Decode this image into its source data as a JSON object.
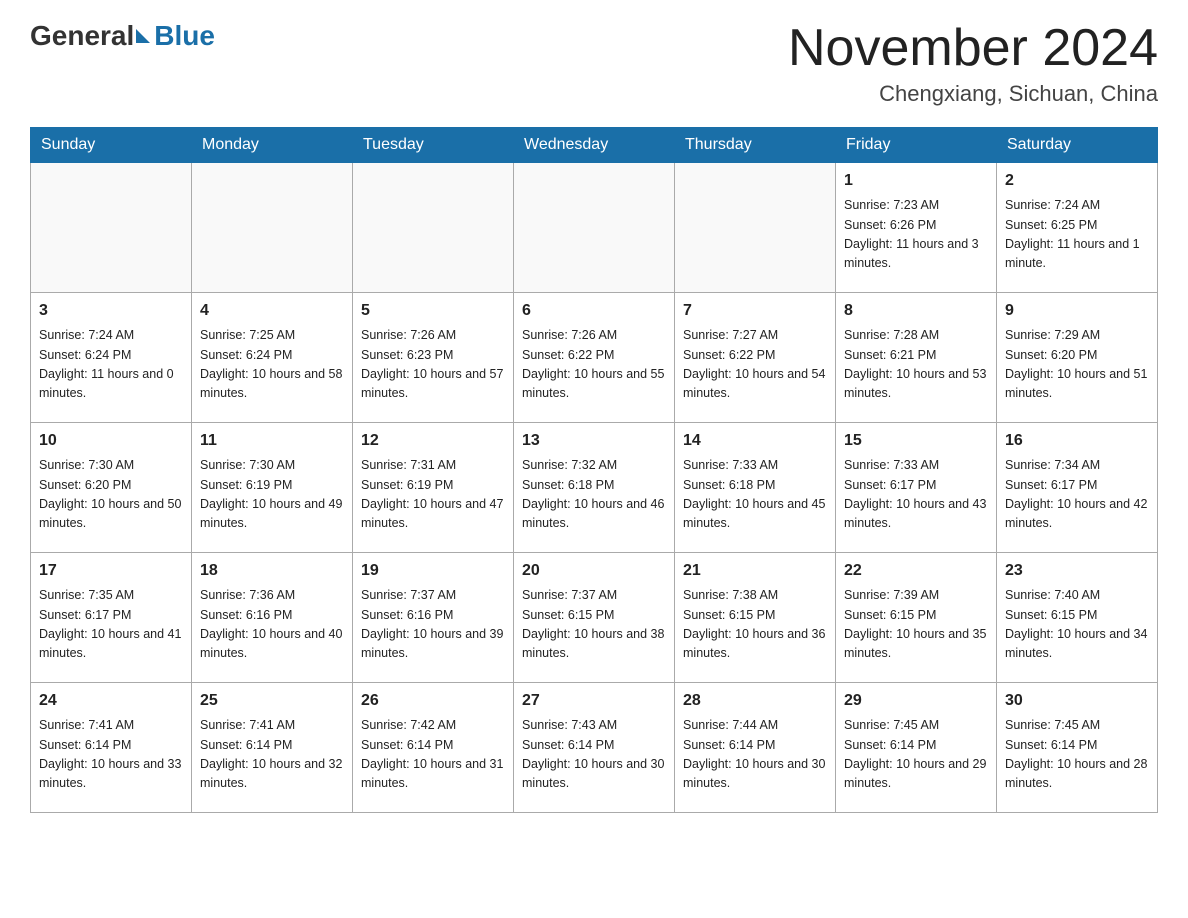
{
  "header": {
    "logo_general": "General",
    "logo_blue": "Blue",
    "month_title": "November 2024",
    "location": "Chengxiang, Sichuan, China"
  },
  "weekdays": [
    "Sunday",
    "Monday",
    "Tuesday",
    "Wednesday",
    "Thursday",
    "Friday",
    "Saturday"
  ],
  "weeks": [
    [
      {
        "day": "",
        "info": ""
      },
      {
        "day": "",
        "info": ""
      },
      {
        "day": "",
        "info": ""
      },
      {
        "day": "",
        "info": ""
      },
      {
        "day": "",
        "info": ""
      },
      {
        "day": "1",
        "info": "Sunrise: 7:23 AM\nSunset: 6:26 PM\nDaylight: 11 hours and 3 minutes."
      },
      {
        "day": "2",
        "info": "Sunrise: 7:24 AM\nSunset: 6:25 PM\nDaylight: 11 hours and 1 minute."
      }
    ],
    [
      {
        "day": "3",
        "info": "Sunrise: 7:24 AM\nSunset: 6:24 PM\nDaylight: 11 hours and 0 minutes."
      },
      {
        "day": "4",
        "info": "Sunrise: 7:25 AM\nSunset: 6:24 PM\nDaylight: 10 hours and 58 minutes."
      },
      {
        "day": "5",
        "info": "Sunrise: 7:26 AM\nSunset: 6:23 PM\nDaylight: 10 hours and 57 minutes."
      },
      {
        "day": "6",
        "info": "Sunrise: 7:26 AM\nSunset: 6:22 PM\nDaylight: 10 hours and 55 minutes."
      },
      {
        "day": "7",
        "info": "Sunrise: 7:27 AM\nSunset: 6:22 PM\nDaylight: 10 hours and 54 minutes."
      },
      {
        "day": "8",
        "info": "Sunrise: 7:28 AM\nSunset: 6:21 PM\nDaylight: 10 hours and 53 minutes."
      },
      {
        "day": "9",
        "info": "Sunrise: 7:29 AM\nSunset: 6:20 PM\nDaylight: 10 hours and 51 minutes."
      }
    ],
    [
      {
        "day": "10",
        "info": "Sunrise: 7:30 AM\nSunset: 6:20 PM\nDaylight: 10 hours and 50 minutes."
      },
      {
        "day": "11",
        "info": "Sunrise: 7:30 AM\nSunset: 6:19 PM\nDaylight: 10 hours and 49 minutes."
      },
      {
        "day": "12",
        "info": "Sunrise: 7:31 AM\nSunset: 6:19 PM\nDaylight: 10 hours and 47 minutes."
      },
      {
        "day": "13",
        "info": "Sunrise: 7:32 AM\nSunset: 6:18 PM\nDaylight: 10 hours and 46 minutes."
      },
      {
        "day": "14",
        "info": "Sunrise: 7:33 AM\nSunset: 6:18 PM\nDaylight: 10 hours and 45 minutes."
      },
      {
        "day": "15",
        "info": "Sunrise: 7:33 AM\nSunset: 6:17 PM\nDaylight: 10 hours and 43 minutes."
      },
      {
        "day": "16",
        "info": "Sunrise: 7:34 AM\nSunset: 6:17 PM\nDaylight: 10 hours and 42 minutes."
      }
    ],
    [
      {
        "day": "17",
        "info": "Sunrise: 7:35 AM\nSunset: 6:17 PM\nDaylight: 10 hours and 41 minutes."
      },
      {
        "day": "18",
        "info": "Sunrise: 7:36 AM\nSunset: 6:16 PM\nDaylight: 10 hours and 40 minutes."
      },
      {
        "day": "19",
        "info": "Sunrise: 7:37 AM\nSunset: 6:16 PM\nDaylight: 10 hours and 39 minutes."
      },
      {
        "day": "20",
        "info": "Sunrise: 7:37 AM\nSunset: 6:15 PM\nDaylight: 10 hours and 38 minutes."
      },
      {
        "day": "21",
        "info": "Sunrise: 7:38 AM\nSunset: 6:15 PM\nDaylight: 10 hours and 36 minutes."
      },
      {
        "day": "22",
        "info": "Sunrise: 7:39 AM\nSunset: 6:15 PM\nDaylight: 10 hours and 35 minutes."
      },
      {
        "day": "23",
        "info": "Sunrise: 7:40 AM\nSunset: 6:15 PM\nDaylight: 10 hours and 34 minutes."
      }
    ],
    [
      {
        "day": "24",
        "info": "Sunrise: 7:41 AM\nSunset: 6:14 PM\nDaylight: 10 hours and 33 minutes."
      },
      {
        "day": "25",
        "info": "Sunrise: 7:41 AM\nSunset: 6:14 PM\nDaylight: 10 hours and 32 minutes."
      },
      {
        "day": "26",
        "info": "Sunrise: 7:42 AM\nSunset: 6:14 PM\nDaylight: 10 hours and 31 minutes."
      },
      {
        "day": "27",
        "info": "Sunrise: 7:43 AM\nSunset: 6:14 PM\nDaylight: 10 hours and 30 minutes."
      },
      {
        "day": "28",
        "info": "Sunrise: 7:44 AM\nSunset: 6:14 PM\nDaylight: 10 hours and 30 minutes."
      },
      {
        "day": "29",
        "info": "Sunrise: 7:45 AM\nSunset: 6:14 PM\nDaylight: 10 hours and 29 minutes."
      },
      {
        "day": "30",
        "info": "Sunrise: 7:45 AM\nSunset: 6:14 PM\nDaylight: 10 hours and 28 minutes."
      }
    ]
  ]
}
